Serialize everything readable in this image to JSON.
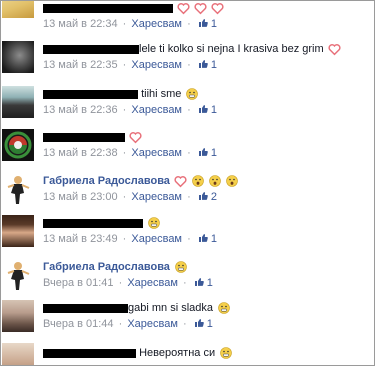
{
  "like_label": "Харесвам",
  "sep": "·",
  "comments": [
    {
      "author": "",
      "text": "",
      "time": "13 май в 22:34",
      "likes": "1"
    },
    {
      "author": "",
      "text": "lele ti kolko si nejna I krasiva bez grim",
      "time": "13 май в 22:35",
      "likes": "1"
    },
    {
      "author": "",
      "text": "tiihi sme",
      "time": "13 май в 22:36",
      "likes": "1"
    },
    {
      "author": "",
      "text": "",
      "time": "13 май в 22:38",
      "likes": "1"
    },
    {
      "author": "Габриела Радославова",
      "text": "",
      "time": "13 май в 23:00",
      "likes": "2"
    },
    {
      "author": "",
      "text": "",
      "time": "13 май в 23:49",
      "likes": "1"
    },
    {
      "author": "Габриела Радославова",
      "text": "",
      "time": "Вчера в 01:41",
      "likes": "1"
    },
    {
      "author": "",
      "text": "gabi mn si sladka",
      "time": "Вчера в 01:44",
      "likes": "1"
    },
    {
      "author": "",
      "text": "Невероятна си",
      "time": "",
      "likes": ""
    }
  ],
  "colors": {
    "link": "#3b5998",
    "meta": "#90949c",
    "heart": "#e8707a",
    "emoji": "#f5cf4a"
  }
}
